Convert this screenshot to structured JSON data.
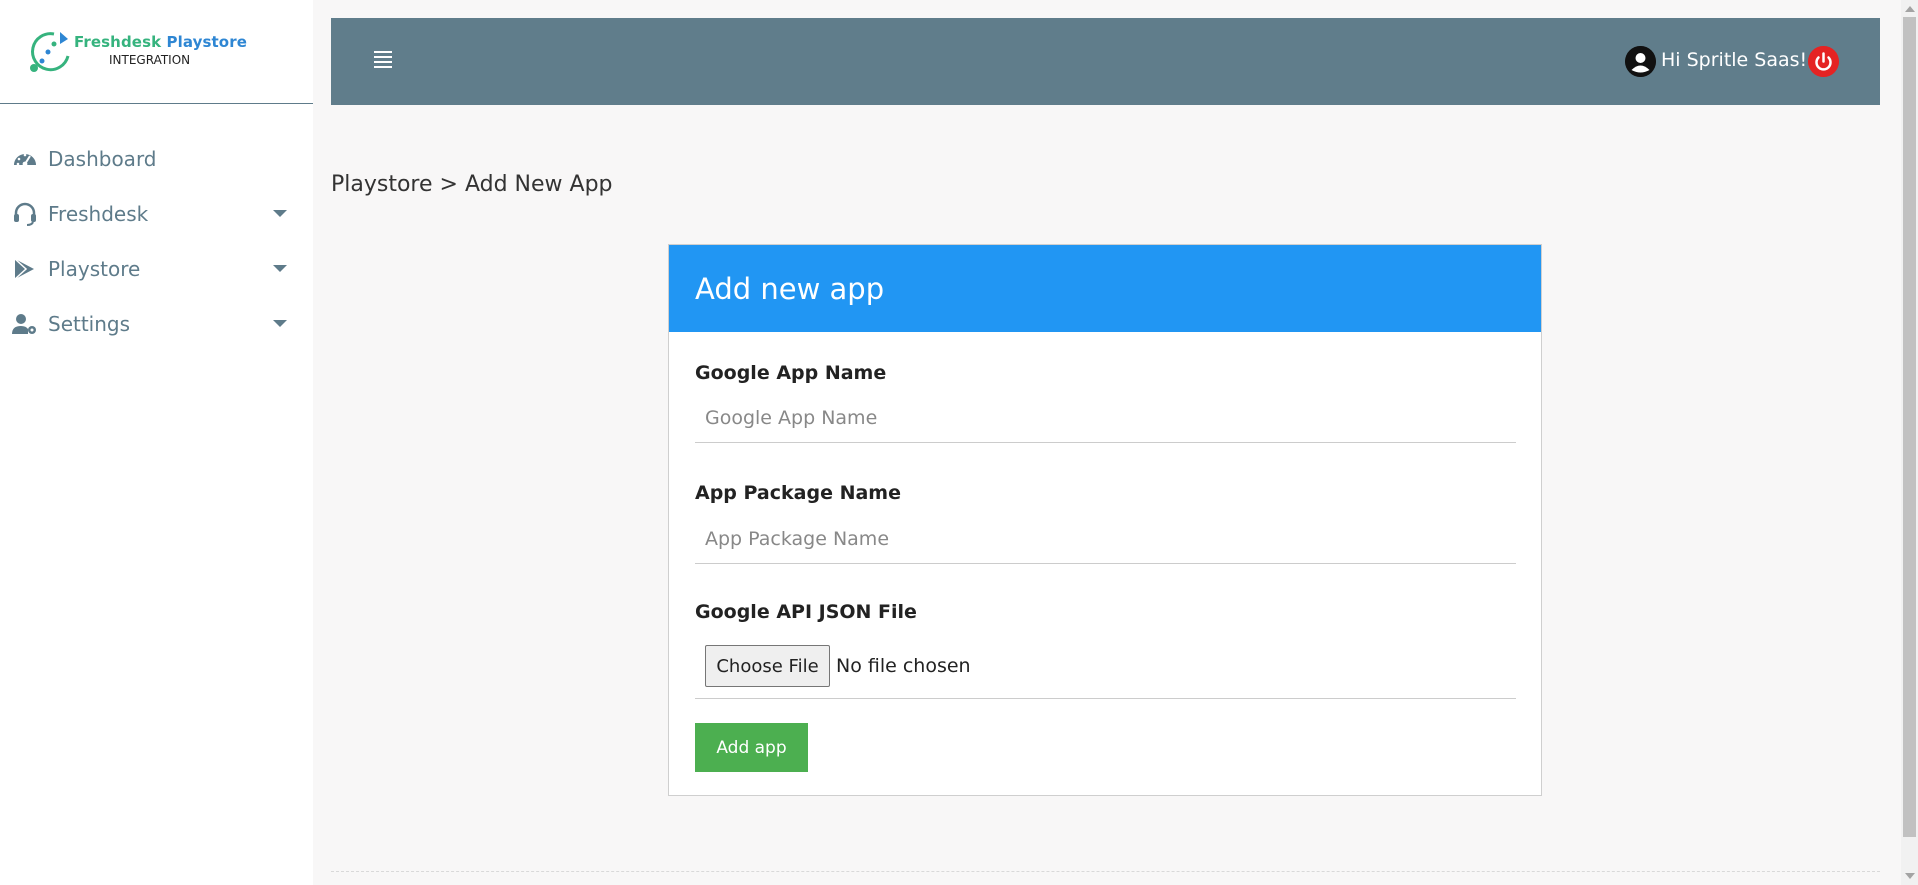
{
  "brand": {
    "line1_part1": "Freshdesk",
    "line1_part2": "Playstore",
    "line2": "INTEGRATION"
  },
  "sidebar": {
    "items": [
      {
        "label": "Dashboard",
        "icon": "dashboard-gauge-icon",
        "has_dropdown": false
      },
      {
        "label": "Freshdesk",
        "icon": "headset-icon",
        "has_dropdown": true
      },
      {
        "label": "Playstore",
        "icon": "play-store-icon",
        "has_dropdown": true
      },
      {
        "label": "Settings",
        "icon": "user-cog-icon",
        "has_dropdown": true
      }
    ]
  },
  "topbar": {
    "menu_icon": "hamburger-menu-icon",
    "greeting": "Hi Spritle Saas!",
    "user_icon": "user-circle-icon",
    "power_icon": "power-icon"
  },
  "breadcrumb": {
    "parent": "Playstore",
    "separator": ">",
    "current": "Add New App"
  },
  "form": {
    "title": "Add new app",
    "app_name": {
      "label": "Google App Name",
      "placeholder": "Google App Name",
      "value": ""
    },
    "package_name": {
      "label": "App Package Name",
      "placeholder": "App Package Name",
      "value": ""
    },
    "json_file": {
      "label": "Google API JSON File",
      "button": "Choose File",
      "status": "No file chosen"
    },
    "submit": "Add app"
  },
  "colors": {
    "topbar": "#607d8b",
    "card_header": "#2196f3",
    "submit": "#4caf50",
    "power": "#e52323",
    "nav_text": "#5e7b8a"
  }
}
